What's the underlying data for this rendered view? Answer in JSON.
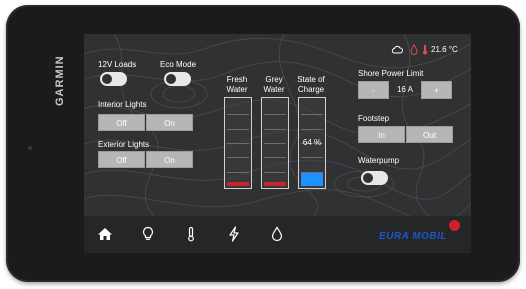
{
  "device": {
    "brand": "GARMIN"
  },
  "status_bar": {
    "temperature": "21.6 °C",
    "icons": [
      "cloud-icon",
      "water-drop-alert-icon",
      "thermometer-icon"
    ]
  },
  "controls": {
    "loads_12v": {
      "label": "12V Loads",
      "on": false
    },
    "eco_mode": {
      "label": "Eco Mode",
      "on": false
    },
    "interior_lights": {
      "label": "Interior Lights",
      "off_label": "Off",
      "on_label": "On"
    },
    "exterior_lights": {
      "label": "Exterior Lights",
      "off_label": "Off",
      "on_label": "On"
    }
  },
  "tanks": {
    "fresh_water": {
      "label_line1": "Fresh",
      "label_line2": "Water",
      "level": 0.05,
      "color": "#c8242b"
    },
    "grey_water": {
      "label_line1": "Grey",
      "label_line2": "Water",
      "level": 0.05,
      "color": "#c8242b"
    },
    "state_of_charge": {
      "label_line1": "State of",
      "label_line2": "Charge",
      "value_text": "64 %",
      "level": 0.15,
      "color": "#1e90ff"
    }
  },
  "shore_power": {
    "label": "Shore Power Limit",
    "minus": "-",
    "value": "16 A",
    "plus": "+"
  },
  "footstep": {
    "label": "Footstep",
    "in_label": "In",
    "out_label": "Out"
  },
  "waterpump": {
    "label": "Waterpump",
    "on": false
  },
  "nav": {
    "items": [
      "home-icon",
      "lightbulb-icon",
      "thermometer-icon",
      "lightning-icon",
      "water-drop-icon"
    ]
  },
  "brand_logo": {
    "text": "EURA MOBIL"
  },
  "colors": {
    "background": "#2f3133",
    "button": "#b4b6b8",
    "navbar": "#242628",
    "logo_blue": "#1e56c8",
    "logo_red": "#d21f2d"
  }
}
